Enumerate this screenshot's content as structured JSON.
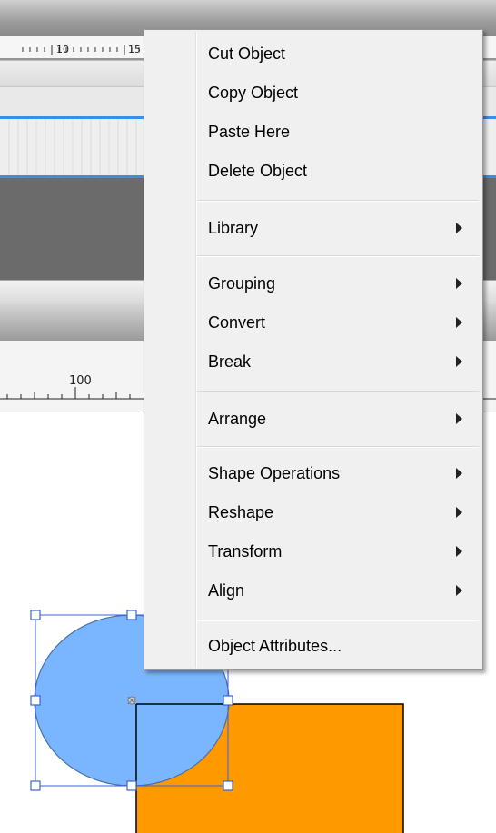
{
  "ruler_top": {
    "tick_a": "10",
    "tick_b": "15"
  },
  "ruler_bottom": {
    "tick": "100"
  },
  "colors": {
    "circle_fill": "#7ab5ff",
    "rect_fill": "#ff9900",
    "timeline_accent": "#3b8fe0"
  },
  "context_menu": {
    "cut": "Cut Object",
    "copy": "Copy Object",
    "paste": "Paste Here",
    "delete": "Delete Object",
    "library": "Library",
    "grouping": "Grouping",
    "convert": "Convert",
    "break": "Break",
    "arrange": "Arrange",
    "shape_operations": "Shape Operations",
    "reshape": "Reshape",
    "transform": "Transform",
    "align": "Align",
    "object_attributes": "Object Attributes..."
  }
}
